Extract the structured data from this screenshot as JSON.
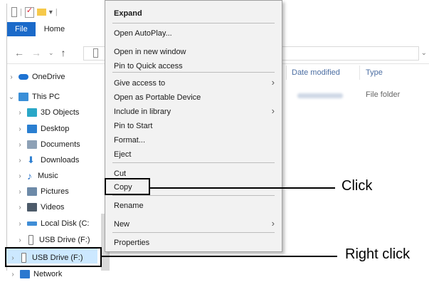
{
  "ribbon": {
    "tabs": [
      "File",
      "Home"
    ]
  },
  "sidebar": {
    "items": [
      {
        "label": "OneDrive",
        "icon": "onedrive-icon",
        "color": "#1e73d2",
        "chevron": "›"
      },
      {
        "label": "This PC",
        "icon": "pc-icon",
        "color": "#3a8fd8",
        "chevron": "⌄"
      },
      {
        "label": "3D Objects",
        "icon": "cube-icon",
        "color": "#2aa7c7",
        "chevron": "›"
      },
      {
        "label": "Desktop",
        "icon": "desktop-icon",
        "color": "#2a7fd1",
        "chevron": "›"
      },
      {
        "label": "Documents",
        "icon": "documents-icon",
        "color": "#8da1b6",
        "chevron": "›"
      },
      {
        "label": "Downloads",
        "icon": "download-icon",
        "color": "#2f80d1",
        "chevron": "›"
      },
      {
        "label": "Music",
        "icon": "music-icon",
        "color": "#2c74c9",
        "chevron": "›"
      },
      {
        "label": "Pictures",
        "icon": "pictures-icon",
        "color": "#6d8aa8",
        "chevron": "›"
      },
      {
        "label": "Videos",
        "icon": "videos-icon",
        "color": "#4d5b6a",
        "chevron": "›"
      },
      {
        "label": "Local Disk (C:",
        "icon": "disk-icon",
        "color": "#3f8dd6",
        "chevron": "›"
      },
      {
        "label": "USB Drive (F:)",
        "icon": "usb-drive-icon",
        "color": "#a3a3a3",
        "chevron": "›"
      },
      {
        "label": "USB Drive (F:)",
        "icon": "usb-drive-icon",
        "color": "#a3a3a3",
        "chevron": "›"
      },
      {
        "label": "Network",
        "icon": "network-icon",
        "color": "#2b78cf",
        "chevron": "›"
      }
    ]
  },
  "columns": {
    "date_modified": "Date modified",
    "type": "Type"
  },
  "row": {
    "type": "File folder"
  },
  "context_menu": {
    "items": [
      {
        "label": "Expand",
        "bold": true
      },
      {
        "label": "Open AutoPlay..."
      },
      {
        "label": "Open in new window"
      },
      {
        "label": "Pin to Quick access"
      },
      {
        "label": "Give access to",
        "submenu": true
      },
      {
        "label": "Open as Portable Device"
      },
      {
        "label": "Include in library",
        "submenu": true
      },
      {
        "label": "Pin to Start"
      },
      {
        "label": "Format..."
      },
      {
        "label": "Eject"
      },
      {
        "label": "Cut"
      },
      {
        "label": "Copy"
      },
      {
        "label": "Rename"
      },
      {
        "label": "New",
        "submenu": true
      },
      {
        "label": "Properties"
      }
    ]
  },
  "callouts": {
    "click": "Click",
    "right_click": "Right click"
  }
}
